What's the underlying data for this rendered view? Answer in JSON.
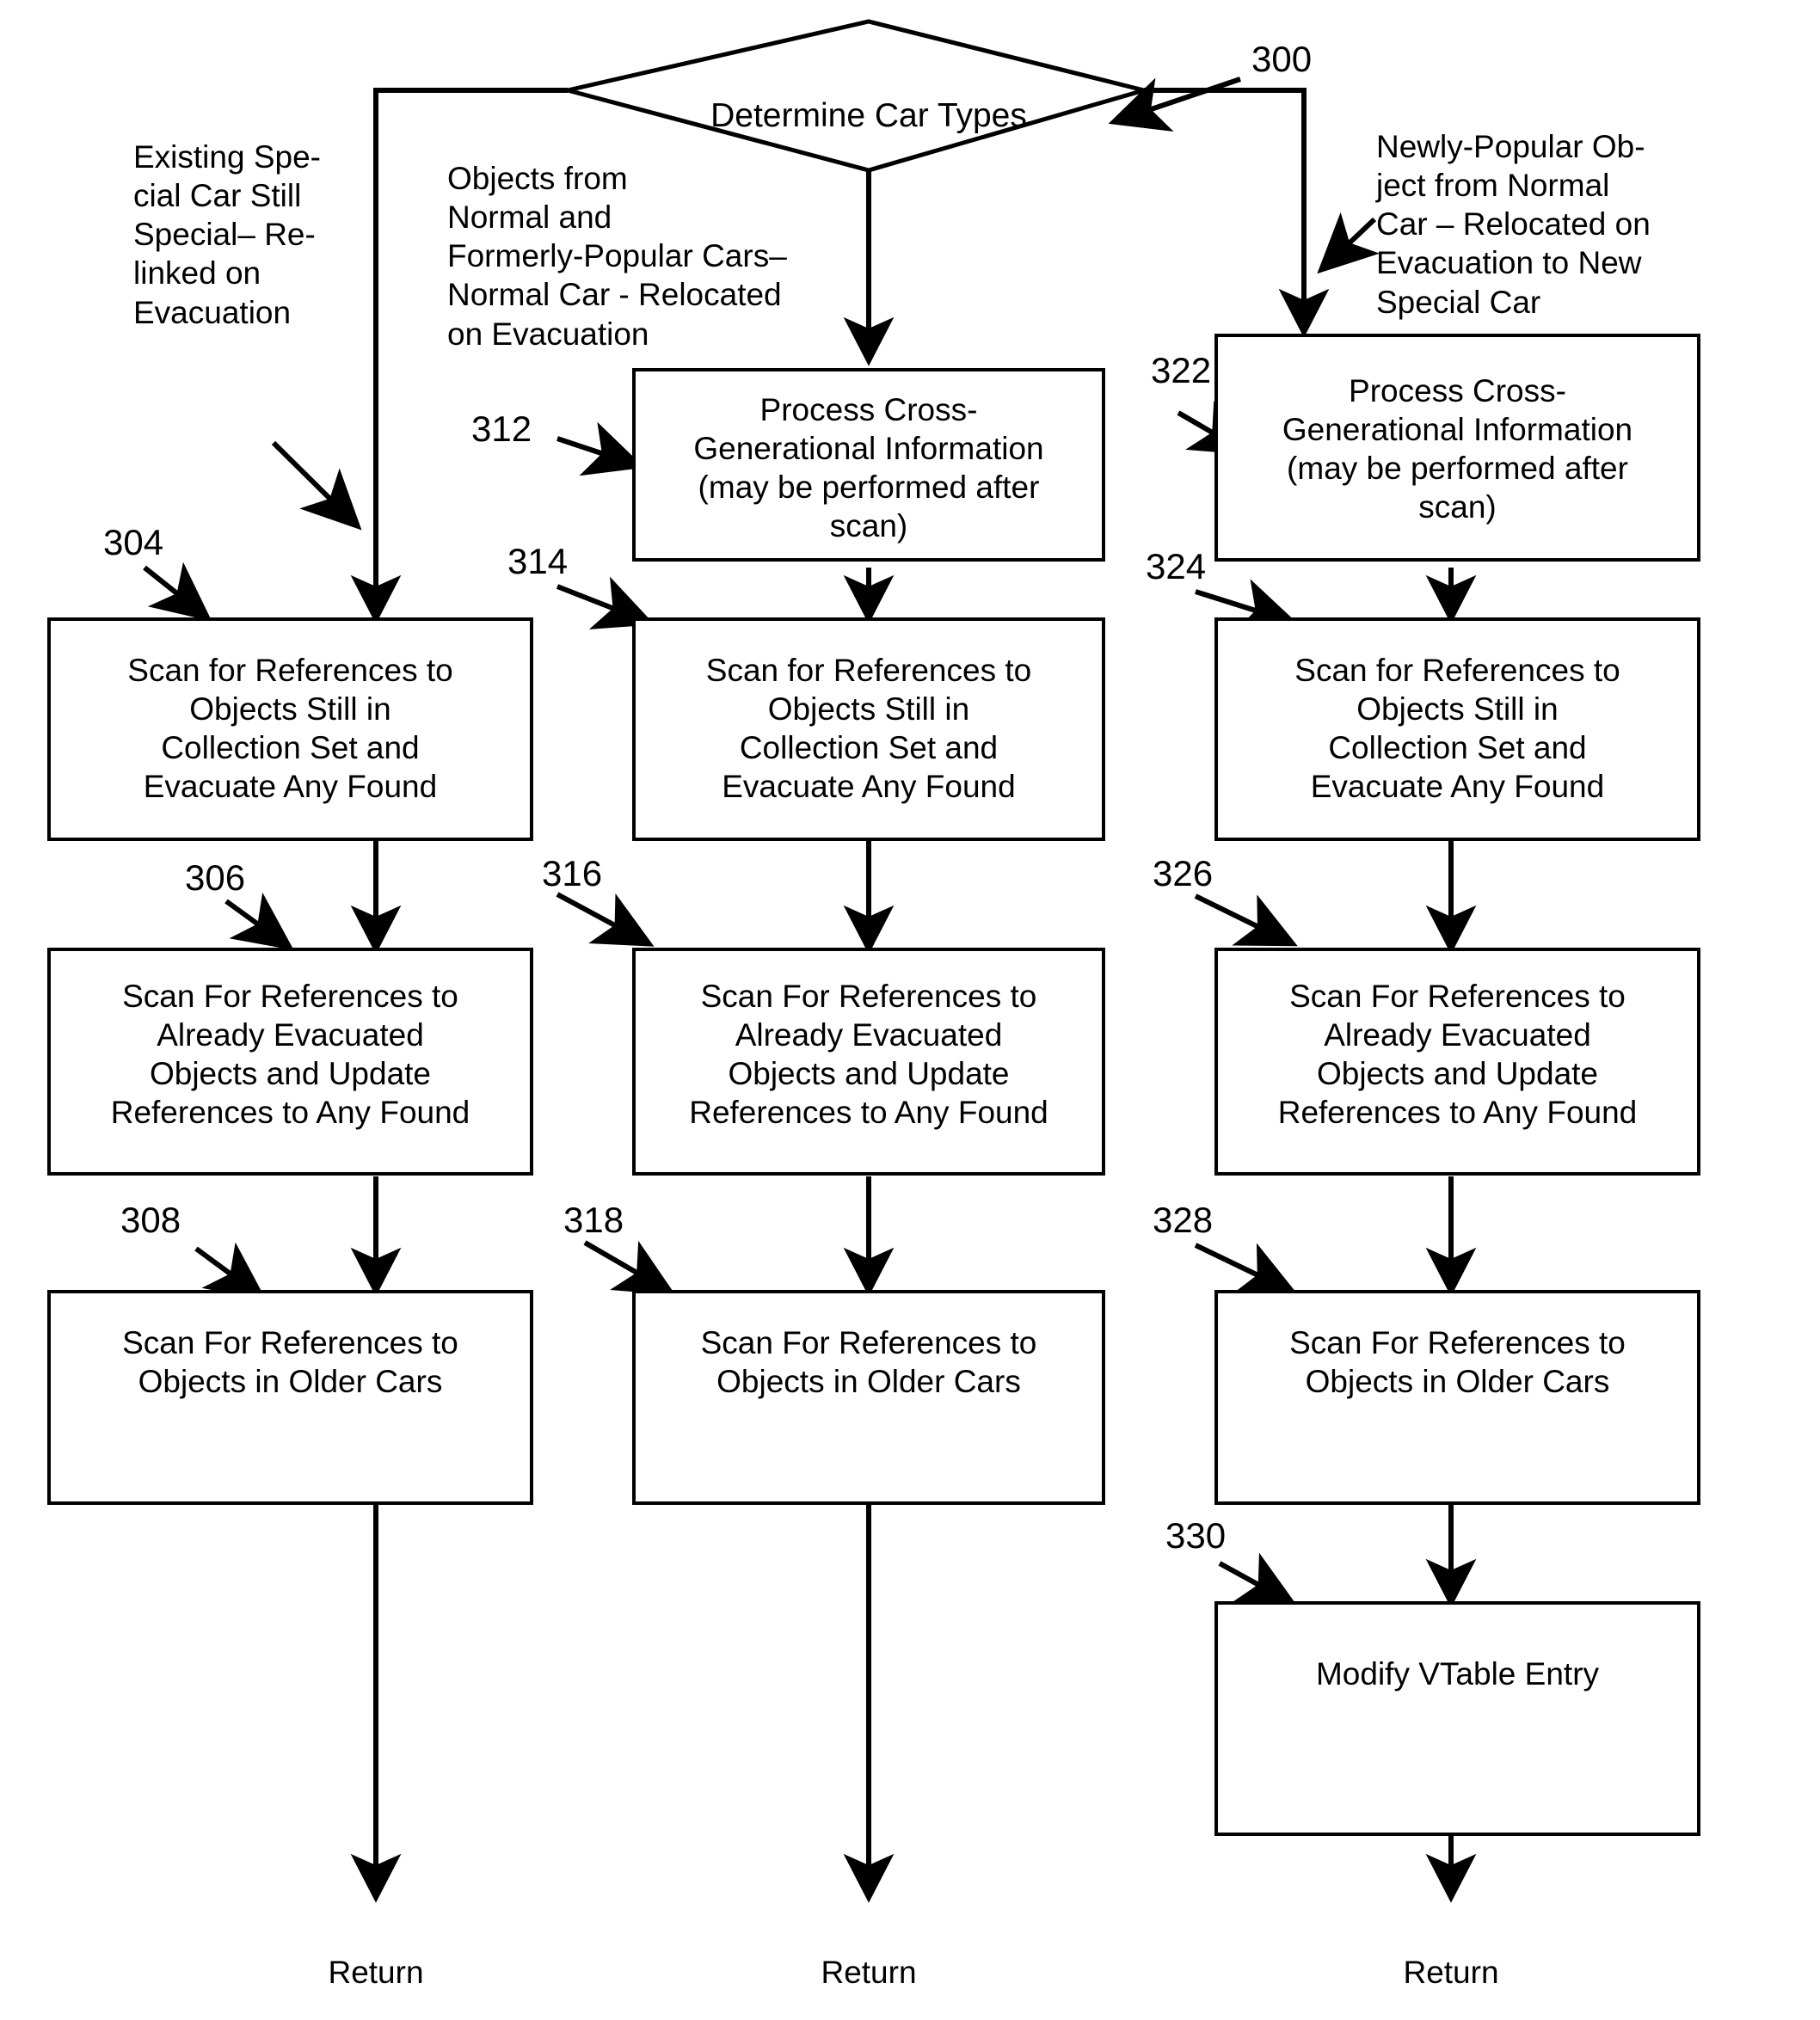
{
  "figure": {
    "ref_300": "300",
    "decision": {
      "label": "Determine Car Types"
    },
    "captions": {
      "left": "Existing Spe-\ncial Car Still\nSpecial– Re-\nlinked on\nEvacuation",
      "middle": "Objects from\nNormal and\nFormerly-Popular Cars–\nNormal Car - Relocated\non Evacuation",
      "right": "Newly-Popular Ob-\nject from Normal\nCar – Relocated on\nEvacuation to New\nSpecial Car"
    },
    "columns": [
      {
        "name": "left-column",
        "refs": [
          "304",
          "306",
          "308"
        ],
        "boxes": [
          "Scan for References to Objects Still in Collection Set and Evacuate Any Found",
          "Scan For References to Already Evacuated Objects and Update References to Any Found",
          "Scan For References to Objects in Older Cars"
        ],
        "terminal": "Return"
      },
      {
        "name": "middle-column",
        "refs": [
          "312",
          "314",
          "316",
          "318"
        ],
        "boxes": [
          "Process Cross-Generational Information (may be performed after scan)",
          "Scan for References to Objects Still in Collection Set and Evacuate Any Found",
          "Scan For References to Already Evacuated Objects and Update References to Any Found",
          "Scan For References to Objects in Older Cars"
        ],
        "terminal": "Return"
      },
      {
        "name": "right-column",
        "refs": [
          "322",
          "324",
          "326",
          "328",
          "330"
        ],
        "boxes": [
          "Process Cross-Generational Information (may be performed after scan)",
          "Scan for References to Objects Still in Collection Set and Evacuate Any Found",
          "Scan For References to Already Evacuated Objects and Update References to Any Found",
          "Scan For References to Objects in Older Cars",
          "Modify VTable Entry"
        ],
        "terminal": "Return"
      }
    ],
    "box_text": {
      "b304_l1": "Scan for References to",
      "b304_l2": "Objects Still in",
      "b304_l3": "Collection Set and",
      "b304_l4": "Evacuate Any Found",
      "b306_l1": "Scan For References to",
      "b306_l2": "Already Evacuated",
      "b306_l3": "Objects and Update",
      "b306_l4": "References to Any Found",
      "b308_l1": "Scan For References to",
      "b308_l2": "Objects in Older Cars",
      "bpcg_l1": "Process Cross-",
      "bpcg_l2": "Generational Information",
      "bpcg_l3": "(may be performed after",
      "bpcg_l4": "scan)",
      "bvtable": "Modify VTable Entry"
    },
    "terminal_label": "Return",
    "colors": {
      "stroke": "#000000",
      "background": "#ffffff"
    }
  }
}
